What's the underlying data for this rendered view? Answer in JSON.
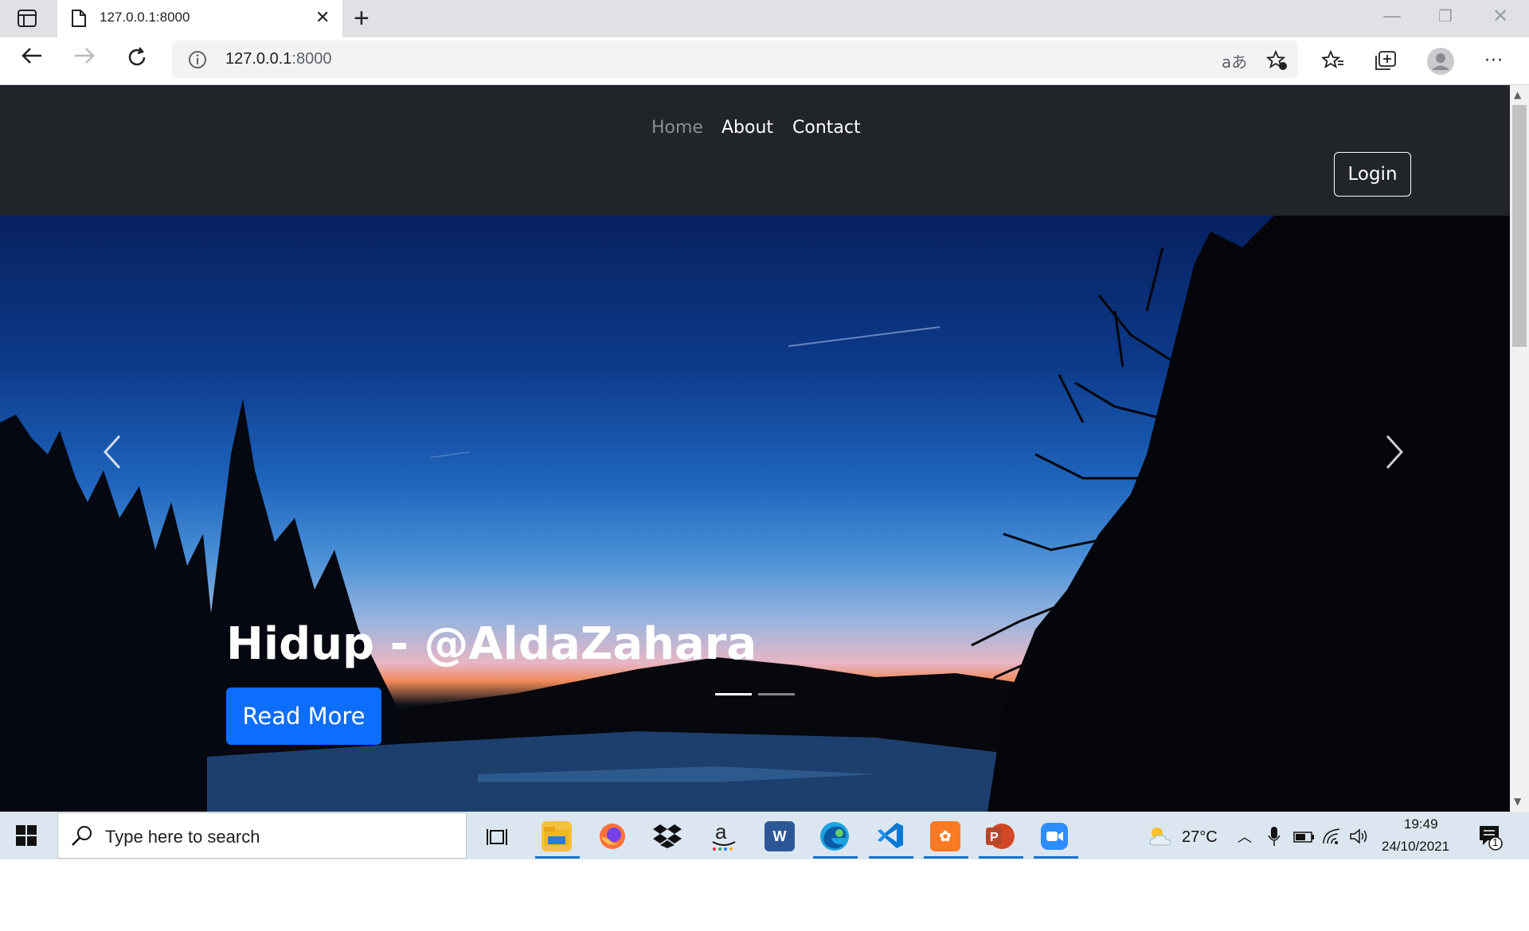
{
  "browser": {
    "tab_title": "127.0.0.1:8000",
    "url_host": "127.0.0.1",
    "url_port": ":8000"
  },
  "site": {
    "nav": {
      "home": "Home",
      "about": "About",
      "contact": "Contact",
      "login": "Login"
    },
    "hero": {
      "caption": "Hidup - @AldaZahara",
      "button": "Read More",
      "slide_count": 2,
      "active_slide": 1
    }
  },
  "taskbar": {
    "search_placeholder": "Type here to search",
    "weather": "27°C",
    "time": "19:49",
    "date": "24/10/2021",
    "notifications": "1",
    "apps": [
      "task-view",
      "file-explorer",
      "firefox",
      "dropbox",
      "amazon",
      "word",
      "edge",
      "vscode",
      "xampp",
      "powerpoint",
      "zoom"
    ]
  },
  "colors": {
    "navbar": "#212529",
    "primary_button": "#0d6efd",
    "taskbar": "#dce6f0"
  }
}
